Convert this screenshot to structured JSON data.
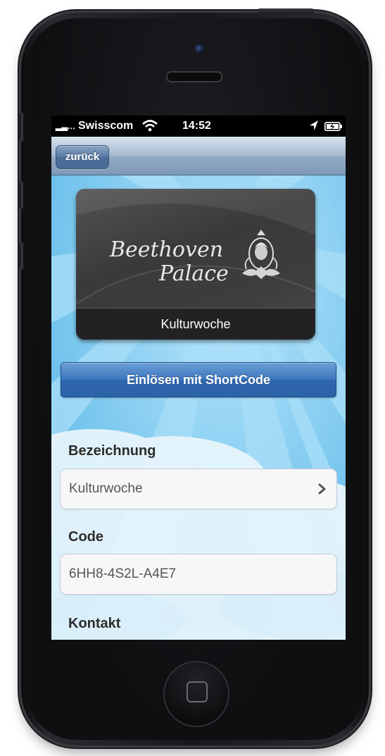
{
  "status_bar": {
    "signal": "▂▃․․․",
    "carrier": "Swisscom",
    "time": "14:52"
  },
  "nav": {
    "back_label": "zurück"
  },
  "card": {
    "logo_line1": "Beethoven",
    "logo_line2": "Palace",
    "caption": "Kulturwoche"
  },
  "actions": {
    "redeem_label": "Einlösen mit ShortCode"
  },
  "form": {
    "designation_label": "Bezeichnung",
    "designation_value": "Kulturwoche",
    "code_label": "Code",
    "code_value": "6HH8-4S2L-A4E7",
    "contact_label": "Kontakt"
  },
  "colors": {
    "nav_bar": "#8ea6c2",
    "primary_button": "#3a72b8",
    "background_sky": "#78c9ef",
    "card": "#3c3c3e"
  },
  "icons": {
    "wifi": "wifi-icon",
    "location": "location-arrow-icon",
    "battery": "battery-charging-icon",
    "chevron": "chevron-right-icon",
    "crest": "beethoven-crest-icon"
  }
}
